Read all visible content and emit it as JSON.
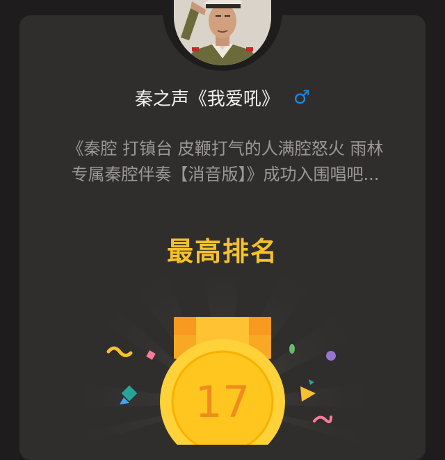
{
  "user": {
    "name": "秦之声《我爱吼》",
    "gender_icon": "male-icon",
    "gender_glyph": "♂",
    "gender_color": "#1e88e5"
  },
  "description": {
    "line1": "《秦腔 打镇台 皮鞭打气的人满腔怒火 雨林",
    "line2": "专属秦腔伴奏【消音版】》成功入围唱吧..."
  },
  "rank": {
    "title": "最高排名",
    "value": "17"
  },
  "colors": {
    "accent": "#f6c22a",
    "medal": "#ffd23a",
    "ribbon": "#f9a825",
    "background": "#1e1c1c",
    "card": "#302d2d"
  }
}
